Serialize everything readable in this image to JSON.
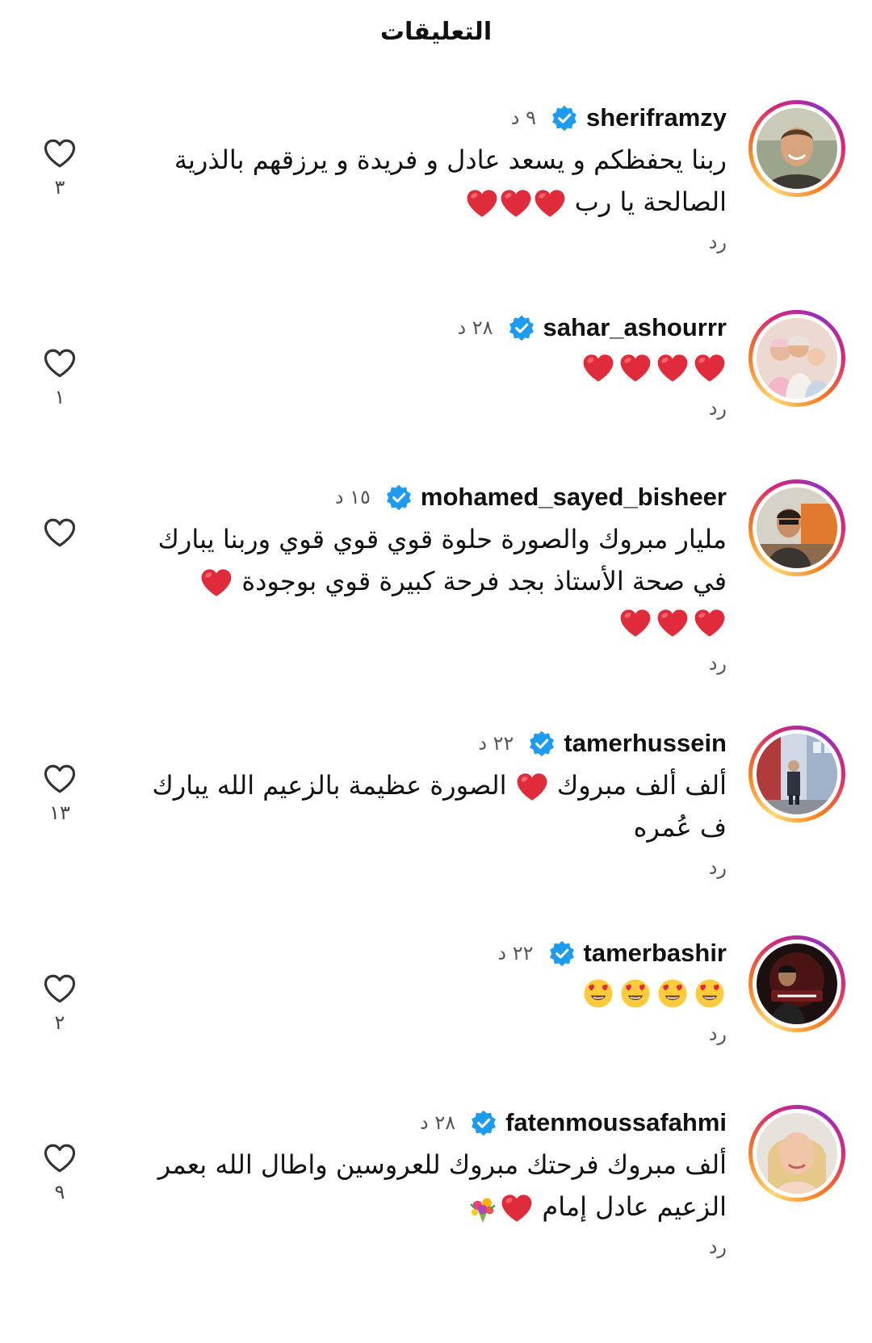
{
  "header": {
    "title": "التعليقات"
  },
  "comments": [
    {
      "username": "sheriframzy",
      "time": "٩ د",
      "text_line1": "ربنا يحفظكم و يسعد عادل و فريدة و يرزقهم بالذرية",
      "text_line2": "الصالحة يا رب",
      "reply_label": "رد",
      "like_count": "٣"
    },
    {
      "username": "sahar_ashourrr",
      "time": "٢٨ د",
      "reply_label": "رد",
      "like_count": "١"
    },
    {
      "username": "mohamed_sayed_bisheer",
      "time": "١٥ د",
      "text_line1": "مليار مبروك والصورة حلوة قوي قوي قوي وربنا يبارك",
      "text_line2": "في صحة الأستاذ بجد فرحة كبيرة قوي بوجودة",
      "reply_label": "رد",
      "like_count": ""
    },
    {
      "username": "tamerhussein",
      "time": "٢٢ د",
      "text_line1a": "ألف ألف مبروك",
      "text_line1b": "الصورة عظيمة بالزعيم الله يبارك",
      "text_line2": "ف عُمره",
      "reply_label": "رد",
      "like_count": "١٣"
    },
    {
      "username": "tamerbashir",
      "time": "٢٢ د",
      "reply_label": "رد",
      "like_count": "٢"
    },
    {
      "username": "fatenmoussafahmi",
      "time": "٢٨ د",
      "text_line1": "ألف مبروك فرحتك مبروك للعروسين واطال الله بعمر",
      "text_line2": "الزعيم عادل إمام",
      "reply_label": "رد",
      "like_count": "٩"
    }
  ],
  "colors": {
    "verified": "#1d9bf0",
    "heart_red": "#e02b3a",
    "text": "#111111",
    "muted": "#555555"
  }
}
